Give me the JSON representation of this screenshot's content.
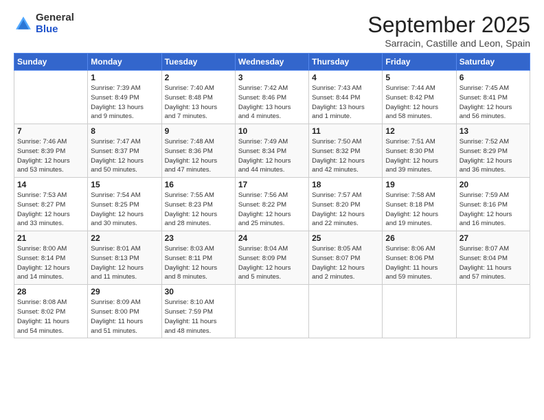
{
  "logo": {
    "general": "General",
    "blue": "Blue"
  },
  "header": {
    "month_title": "September 2025",
    "location": "Sarracin, Castille and Leon, Spain"
  },
  "weekdays": [
    "Sunday",
    "Monday",
    "Tuesday",
    "Wednesday",
    "Thursday",
    "Friday",
    "Saturday"
  ],
  "weeks": [
    [
      {
        "day": "",
        "info": ""
      },
      {
        "day": "1",
        "info": "Sunrise: 7:39 AM\nSunset: 8:49 PM\nDaylight: 13 hours\nand 9 minutes."
      },
      {
        "day": "2",
        "info": "Sunrise: 7:40 AM\nSunset: 8:48 PM\nDaylight: 13 hours\nand 7 minutes."
      },
      {
        "day": "3",
        "info": "Sunrise: 7:42 AM\nSunset: 8:46 PM\nDaylight: 13 hours\nand 4 minutes."
      },
      {
        "day": "4",
        "info": "Sunrise: 7:43 AM\nSunset: 8:44 PM\nDaylight: 13 hours\nand 1 minute."
      },
      {
        "day": "5",
        "info": "Sunrise: 7:44 AM\nSunset: 8:42 PM\nDaylight: 12 hours\nand 58 minutes."
      },
      {
        "day": "6",
        "info": "Sunrise: 7:45 AM\nSunset: 8:41 PM\nDaylight: 12 hours\nand 56 minutes."
      }
    ],
    [
      {
        "day": "7",
        "info": "Sunrise: 7:46 AM\nSunset: 8:39 PM\nDaylight: 12 hours\nand 53 minutes."
      },
      {
        "day": "8",
        "info": "Sunrise: 7:47 AM\nSunset: 8:37 PM\nDaylight: 12 hours\nand 50 minutes."
      },
      {
        "day": "9",
        "info": "Sunrise: 7:48 AM\nSunset: 8:36 PM\nDaylight: 12 hours\nand 47 minutes."
      },
      {
        "day": "10",
        "info": "Sunrise: 7:49 AM\nSunset: 8:34 PM\nDaylight: 12 hours\nand 44 minutes."
      },
      {
        "day": "11",
        "info": "Sunrise: 7:50 AM\nSunset: 8:32 PM\nDaylight: 12 hours\nand 42 minutes."
      },
      {
        "day": "12",
        "info": "Sunrise: 7:51 AM\nSunset: 8:30 PM\nDaylight: 12 hours\nand 39 minutes."
      },
      {
        "day": "13",
        "info": "Sunrise: 7:52 AM\nSunset: 8:29 PM\nDaylight: 12 hours\nand 36 minutes."
      }
    ],
    [
      {
        "day": "14",
        "info": "Sunrise: 7:53 AM\nSunset: 8:27 PM\nDaylight: 12 hours\nand 33 minutes."
      },
      {
        "day": "15",
        "info": "Sunrise: 7:54 AM\nSunset: 8:25 PM\nDaylight: 12 hours\nand 30 minutes."
      },
      {
        "day": "16",
        "info": "Sunrise: 7:55 AM\nSunset: 8:23 PM\nDaylight: 12 hours\nand 28 minutes."
      },
      {
        "day": "17",
        "info": "Sunrise: 7:56 AM\nSunset: 8:22 PM\nDaylight: 12 hours\nand 25 minutes."
      },
      {
        "day": "18",
        "info": "Sunrise: 7:57 AM\nSunset: 8:20 PM\nDaylight: 12 hours\nand 22 minutes."
      },
      {
        "day": "19",
        "info": "Sunrise: 7:58 AM\nSunset: 8:18 PM\nDaylight: 12 hours\nand 19 minutes."
      },
      {
        "day": "20",
        "info": "Sunrise: 7:59 AM\nSunset: 8:16 PM\nDaylight: 12 hours\nand 16 minutes."
      }
    ],
    [
      {
        "day": "21",
        "info": "Sunrise: 8:00 AM\nSunset: 8:14 PM\nDaylight: 12 hours\nand 14 minutes."
      },
      {
        "day": "22",
        "info": "Sunrise: 8:01 AM\nSunset: 8:13 PM\nDaylight: 12 hours\nand 11 minutes."
      },
      {
        "day": "23",
        "info": "Sunrise: 8:03 AM\nSunset: 8:11 PM\nDaylight: 12 hours\nand 8 minutes."
      },
      {
        "day": "24",
        "info": "Sunrise: 8:04 AM\nSunset: 8:09 PM\nDaylight: 12 hours\nand 5 minutes."
      },
      {
        "day": "25",
        "info": "Sunrise: 8:05 AM\nSunset: 8:07 PM\nDaylight: 12 hours\nand 2 minutes."
      },
      {
        "day": "26",
        "info": "Sunrise: 8:06 AM\nSunset: 8:06 PM\nDaylight: 11 hours\nand 59 minutes."
      },
      {
        "day": "27",
        "info": "Sunrise: 8:07 AM\nSunset: 8:04 PM\nDaylight: 11 hours\nand 57 minutes."
      }
    ],
    [
      {
        "day": "28",
        "info": "Sunrise: 8:08 AM\nSunset: 8:02 PM\nDaylight: 11 hours\nand 54 minutes."
      },
      {
        "day": "29",
        "info": "Sunrise: 8:09 AM\nSunset: 8:00 PM\nDaylight: 11 hours\nand 51 minutes."
      },
      {
        "day": "30",
        "info": "Sunrise: 8:10 AM\nSunset: 7:59 PM\nDaylight: 11 hours\nand 48 minutes."
      },
      {
        "day": "",
        "info": ""
      },
      {
        "day": "",
        "info": ""
      },
      {
        "day": "",
        "info": ""
      },
      {
        "day": "",
        "info": ""
      }
    ]
  ]
}
